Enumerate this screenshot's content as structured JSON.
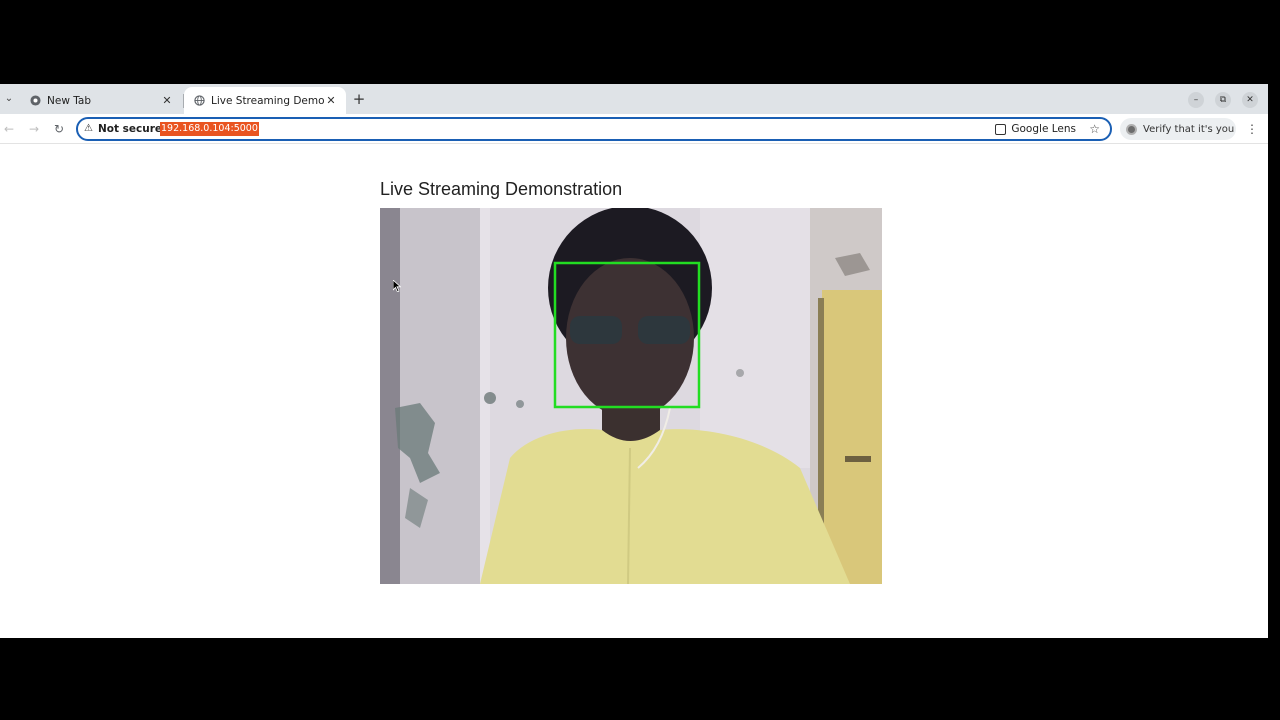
{
  "tabs": [
    {
      "title": "New Tab",
      "active": false
    },
    {
      "title": "Live Streaming Demonst",
      "active": true
    }
  ],
  "address_bar": {
    "security_label": "Not secure",
    "url": "192.168.0.104:5000",
    "lens_label": "Google Lens"
  },
  "profile": {
    "label": "Verify that it's you"
  },
  "page": {
    "heading": "Live Streaming Demonstration"
  },
  "video_stream": {
    "face_box_color": "#22dd22"
  },
  "icons": [
    "tab-search-icon",
    "chrome-icon",
    "globe-icon",
    "close-icon",
    "plus-icon",
    "minimize-icon",
    "restore-icon",
    "back-icon",
    "forward-icon",
    "reload-icon",
    "warning-icon",
    "lens-icon",
    "star-icon",
    "avatar-icon",
    "menu-icon"
  ]
}
